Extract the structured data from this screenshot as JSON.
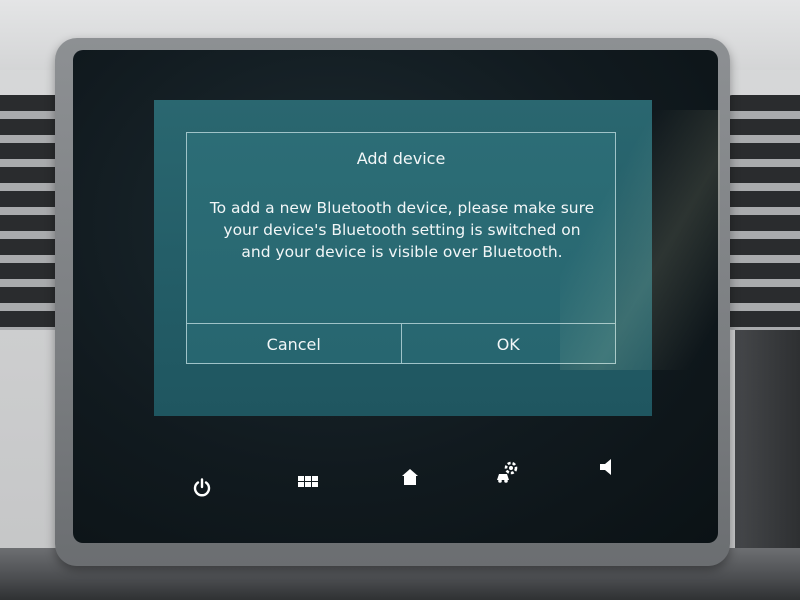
{
  "dialog": {
    "title": "Add device",
    "message": "To add a new Bluetooth device, please make sure your device's Bluetooth setting is switched on and your device is visible over Bluetooth.",
    "cancel_label": "Cancel",
    "ok_label": "OK"
  },
  "controls": [
    {
      "name": "power",
      "icon": "power-icon"
    },
    {
      "name": "menu",
      "icon": "apps-grid-icon"
    },
    {
      "name": "home",
      "icon": "home-icon"
    },
    {
      "name": "settings",
      "icon": "car-settings-icon"
    },
    {
      "name": "volume",
      "icon": "speaker-icon"
    }
  ],
  "colors": {
    "display_bg": "#245e68",
    "dialog_border": "#9fc3c8",
    "text": "#f2f6f7",
    "icon": "#ffffff"
  }
}
